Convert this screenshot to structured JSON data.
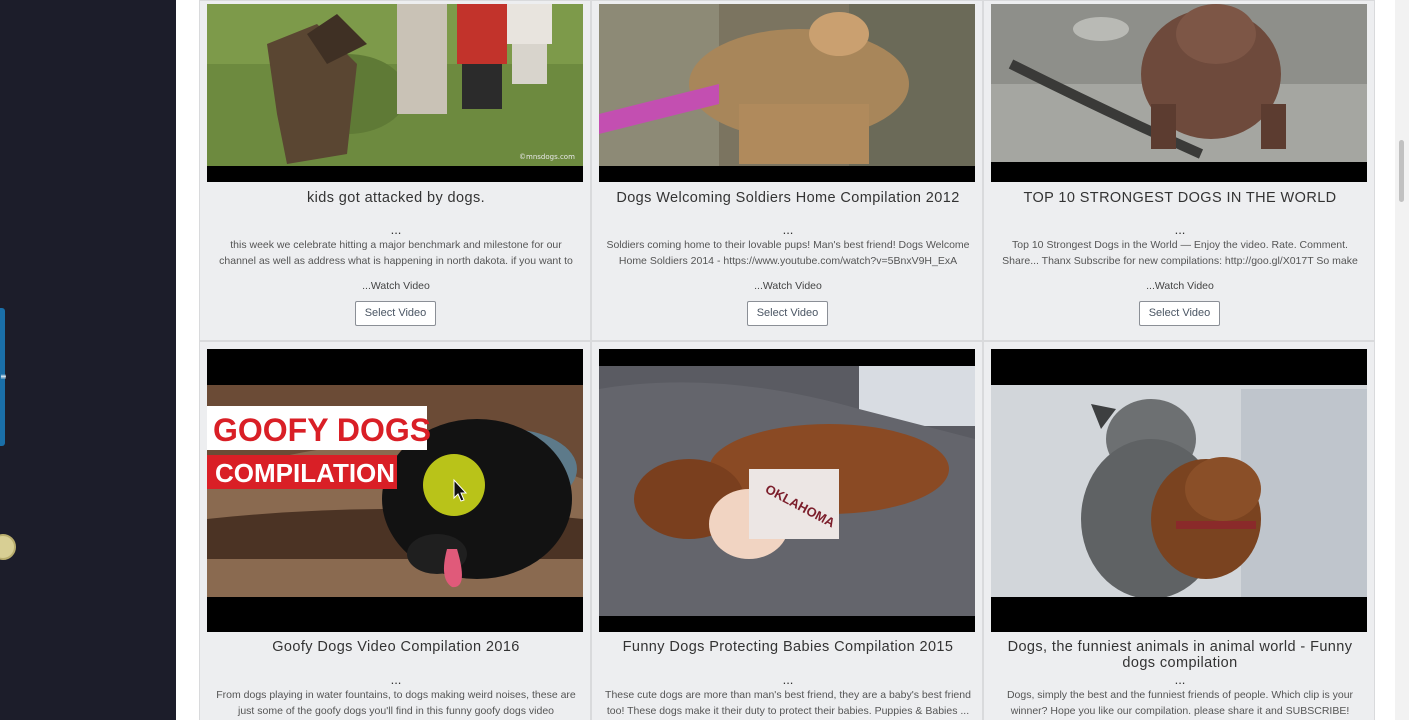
{
  "sidebar_panel": {
    "tab_glyph": "≡"
  },
  "cards": [
    {
      "title": "kids got attacked by dogs.",
      "ellipsis": "...",
      "description": "this week we celebrate hitting a major benchmark and milestone for our channel as well as address what is happening in north dakota. if you want to",
      "watch_label": "...Watch Video",
      "button_label": "Select Video",
      "watermark": "©mnsdogs.com"
    },
    {
      "title": "Dogs Welcoming Soldiers Home Compilation 2012",
      "ellipsis": "...",
      "description": "Soldiers coming home to their lovable pups! Man's best friend! Dogs Welcome Home Soldiers 2014 - https://www.youtube.com/watch?v=5BnxV9H_ExA",
      "watch_label": "...Watch Video",
      "button_label": "Select Video"
    },
    {
      "title": "TOP 10 STRONGEST DOGS IN THE WORLD",
      "ellipsis": "...",
      "description": "Top 10 Strongest Dogs in the World — Enjoy the video. Rate. Comment. Share... Thanx Subscribe for new compilations: http://goo.gl/X017T So make",
      "watch_label": "...Watch Video",
      "button_label": "Select Video"
    },
    {
      "title": "Goofy Dogs Video Compilation 2016",
      "ellipsis": "...",
      "description": "From dogs playing in water fountains, to dogs making weird noises, these are just some of the goofy dogs you'll find in this funny goofy dogs video",
      "overlay_line1": "GOOFY DOGS",
      "overlay_line2": "COMPILATION"
    },
    {
      "title": "Funny Dogs Protecting Babies Compilation 2015",
      "ellipsis": "...",
      "description": "These cute dogs are more than man's best friend, they are a baby's best friend too! These dogs make it their duty to protect their babies. Puppies & Babies ...",
      "shirt_text": "OKLAHOMA"
    },
    {
      "title": "Dogs, the funniest animals in animal world - Funny dogs compilation",
      "ellipsis": "...",
      "description": "Dogs, simply the best and the funniest friends of people. Which clip is your winner? Hope you like our compilation. please share it and SUBSCRIBE! Watch"
    }
  ],
  "colors": {
    "sidebar_bg": "#1c1d2a",
    "card_bg": "#edeef0",
    "accent_tab": "#1a6fa8",
    "overlay_red": "#d91f26"
  }
}
